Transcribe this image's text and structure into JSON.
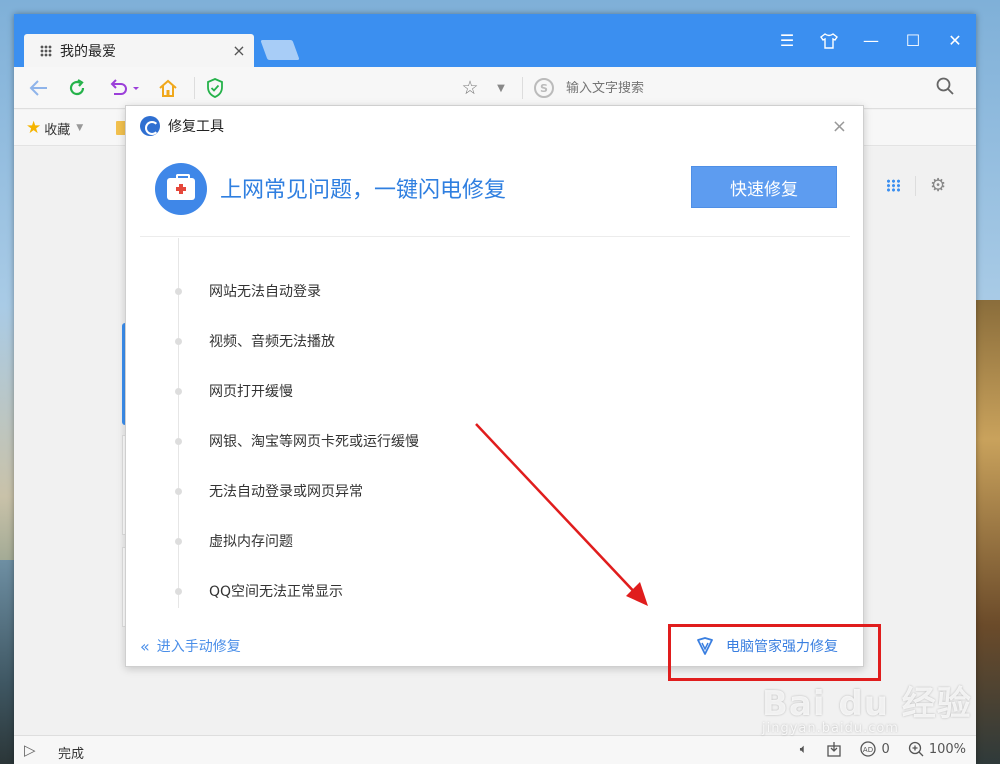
{
  "browser": {
    "tab_title": "我的最爱",
    "tab_close": "×",
    "window_buttons": [
      "☰",
      "shirt-icon",
      "—",
      "☐",
      "✕"
    ],
    "search_placeholder": "输入文字搜索",
    "search_logo": "S",
    "bookmark_label": "收藏"
  },
  "dialog": {
    "title": "修复工具",
    "close": "×",
    "headline": "上网常见问题，一键闪电修复",
    "quick_fix_button": "快速修复",
    "issues": [
      "网站无法自动登录",
      "视频、音频无法播放",
      "网页打开缓慢",
      "网银、淘宝等网页卡死或运行缓慢",
      "无法自动登录或网页异常",
      "虚拟内存问题",
      "QQ空间无法正常显示"
    ],
    "manual_repair_link": "进入手动修复",
    "pc_manager_link": "电脑管家强力修复"
  },
  "statusbar": {
    "status_text": "完成",
    "ad_count": "0",
    "zoom": "100%"
  },
  "watermark": {
    "logo": "Bai du 经验",
    "url": "jingyan.baidu.com"
  },
  "colors": {
    "titlebar": "#3b8ff0",
    "accent": "#2f7fe0",
    "button": "#5d9cf0",
    "annotation": "#e01d1d"
  }
}
